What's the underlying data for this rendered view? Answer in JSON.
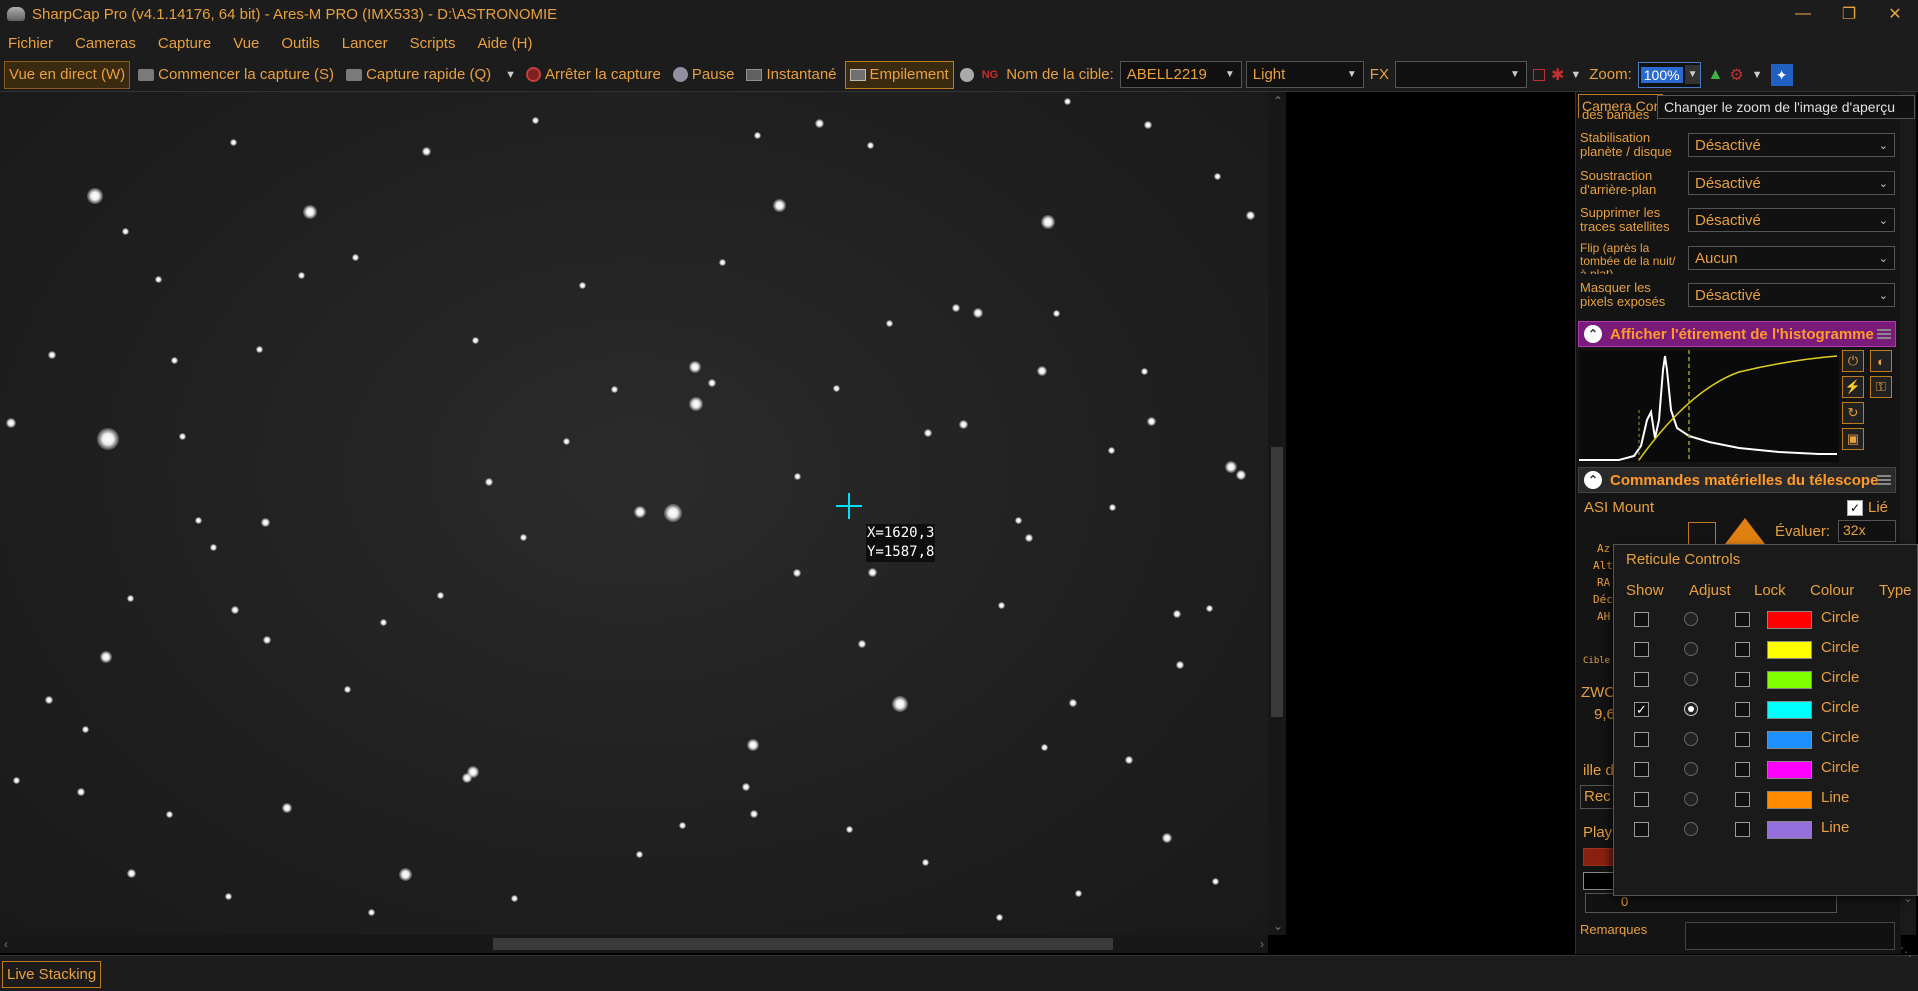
{
  "window": {
    "title": "SharpCap Pro (v4.1.14176, 64 bit) - Ares-M PRO (IMX533) - D:\\ASTRONOMIE",
    "min_icon": "minimize-icon",
    "max_icon": "restore-icon",
    "close_icon": "close-icon"
  },
  "menu": [
    "Fichier",
    "Cameras",
    "Capture",
    "Vue",
    "Outils",
    "Lancer",
    "Scripts",
    "Aide (H)"
  ],
  "toolbar": {
    "live_view": "Vue en direct (W)",
    "start_capture": "Commencer la capture (S)",
    "quick_capture": "Capture rapide (Q)",
    "stop_capture": "Arrêter la capture",
    "pause": "Pause",
    "snapshot": "Instantané",
    "stacking": "Empilement",
    "target_label": "Nom de la cible:",
    "target_value": "ABELL2219",
    "frame_type": "Light",
    "fx_label": "FX",
    "fx_value": "",
    "zoom_label": "Zoom:",
    "zoom_value": "100%"
  },
  "viewport": {
    "coord_x": "X=1620,3",
    "coord_y": "Y=1587,8",
    "crosshair_color": "#00e0ff"
  },
  "panel": {
    "tab_label": "Camera Controls",
    "tooltip": "Changer le zoom de l'image d'aperçu",
    "cut_label": "des bandes",
    "rows": [
      {
        "label": "Stabilisation planète / disque",
        "value": "Désactivé"
      },
      {
        "label": "Soustraction d'arrière-plan",
        "value": "Désactivé"
      },
      {
        "label": "Supprimer les traces satellites",
        "value": "Désactivé"
      },
      {
        "label": "Flip (après la tombée de la nuit/à plat)",
        "value": "Aucun"
      },
      {
        "label": "Masquer les pixels exposés",
        "value": "Désactivé"
      }
    ],
    "histogram_title": "Afficher l'étirement de l'histogramme",
    "telescope_title": "Commandes matérielles du télescope",
    "mount_name": "ASI Mount",
    "linked_label": "Lié",
    "evaluate_label": "Évaluer:",
    "evaluate_value": "32x",
    "tele_lines": [
      "Az",
      "Alt",
      "RA",
      "Déc",
      "AH"
    ],
    "cible_label": "Cible :",
    "zwo_label": "ZWO",
    "zwo_value": "9,6",
    "ille_label": "ille d",
    "rec_label": "Rec",
    "play_label": "Play",
    "zero_label": "0",
    "remarks_label": "Remarques"
  },
  "reticule": {
    "title": "Reticule Controls",
    "headers": [
      "Show",
      "Adjust",
      "Lock",
      "Colour",
      "Type"
    ],
    "rows": [
      {
        "show": false,
        "adjust": false,
        "lock": false,
        "color": "#ff0000",
        "type": "Circle"
      },
      {
        "show": false,
        "adjust": false,
        "lock": false,
        "color": "#ffff00",
        "type": "Circle"
      },
      {
        "show": false,
        "adjust": false,
        "lock": false,
        "color": "#80ff00",
        "type": "Circle"
      },
      {
        "show": true,
        "adjust": true,
        "lock": false,
        "color": "#00ffff",
        "type": "Circle"
      },
      {
        "show": false,
        "adjust": false,
        "lock": false,
        "color": "#1e90ff",
        "type": "Circle"
      },
      {
        "show": false,
        "adjust": false,
        "lock": false,
        "color": "#ff00ff",
        "type": "Circle"
      },
      {
        "show": false,
        "adjust": false,
        "lock": false,
        "color": "#ff8c00",
        "type": "Line"
      },
      {
        "show": false,
        "adjust": false,
        "lock": false,
        "color": "#9370db",
        "type": "Line"
      }
    ]
  },
  "status": {
    "live_stacking": "Live Stacking"
  }
}
